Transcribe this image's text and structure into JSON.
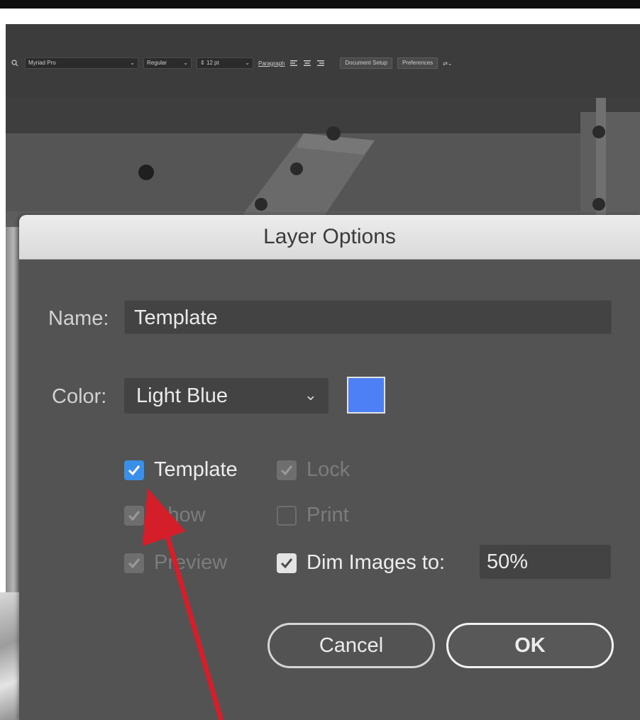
{
  "toolbar": {
    "font_name": "Myriad Pro",
    "font_style": "Regular",
    "font_size": "12 pt",
    "paragraph_label": "Paragraph",
    "document_setup_label": "Document Setup",
    "preferences_label": "Preferences"
  },
  "dialog": {
    "title": "Layer Options",
    "name_label": "Name:",
    "name_value": "Template",
    "color_label": "Color:",
    "color_value": "Light Blue",
    "swatch_color": "#4d7ff5",
    "options": {
      "template": {
        "label": "Template",
        "checked": true
      },
      "lock": {
        "label": "Lock",
        "checked": true,
        "enabled": false
      },
      "show": {
        "label": "Show",
        "checked": true,
        "enabled": false
      },
      "print": {
        "label": "Print",
        "checked": false,
        "enabled": false
      },
      "preview": {
        "label": "Preview",
        "checked": true,
        "enabled": false
      },
      "dim_images": {
        "label": "Dim Images to:",
        "checked": true
      }
    },
    "dim_value": "50%",
    "cancel_label": "Cancel",
    "ok_label": "OK"
  },
  "annotation": {
    "arrow_color": "#d41f2a"
  }
}
